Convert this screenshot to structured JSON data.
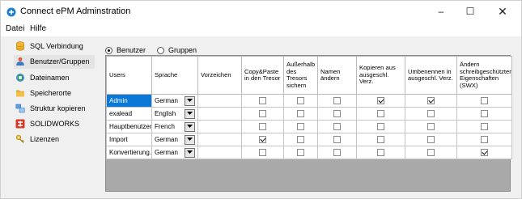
{
  "window": {
    "title": "Connect ePM Adminstration",
    "controls": {
      "minimize": "–",
      "maximize": "☐",
      "close": "✕"
    }
  },
  "menu": {
    "datei": "Datei",
    "hilfe": "Hilfe"
  },
  "sidebar": {
    "items": [
      {
        "label": "SQL Verbindung",
        "icon": "database-icon",
        "selected": false
      },
      {
        "label": "Benutzer/Gruppen",
        "icon": "users-icon",
        "selected": true
      },
      {
        "label": "Dateinamen",
        "icon": "filenames-icon",
        "selected": false
      },
      {
        "label": "Speicherorte",
        "icon": "folder-icon",
        "selected": false
      },
      {
        "label": "Struktur kopieren",
        "icon": "copy-structure-icon",
        "selected": false
      },
      {
        "label": "SOLIDWORKS",
        "icon": "solidworks-icon",
        "selected": false
      },
      {
        "label": "Lizenzen",
        "icon": "key-icon",
        "selected": false
      }
    ]
  },
  "mode": {
    "benutzer": "Benutzer",
    "gruppen": "Gruppen",
    "selected": "benutzer"
  },
  "table": {
    "columns": [
      "Users",
      "Sprache",
      "Vorzeichen",
      "Copy&Paste in den Tresor",
      "Außerhalb des Tresors sichern",
      "Namen ändern",
      "Kopieren aus ausgeschl. Verz.",
      "Umbenennen in ausgeschl. Verz.",
      "Ändern schreibgeschützter Eigenschaften (SWX)"
    ],
    "rows": [
      {
        "user": "Admin",
        "sprache": "German",
        "vorzeichen": "",
        "checks": [
          false,
          false,
          false,
          true,
          true,
          false
        ]
      },
      {
        "user": "exalead",
        "sprache": "English",
        "vorzeichen": "",
        "checks": [
          false,
          false,
          false,
          false,
          false,
          false
        ]
      },
      {
        "user": "Hauptbenutzer",
        "sprache": "French",
        "vorzeichen": "",
        "checks": [
          false,
          false,
          false,
          false,
          false,
          false
        ]
      },
      {
        "user": "Import",
        "sprache": "German",
        "vorzeichen": "",
        "checks": [
          true,
          false,
          false,
          false,
          false,
          false
        ]
      },
      {
        "user": "Konvertierung...",
        "sprache": "German",
        "vorzeichen": "",
        "checks": [
          false,
          false,
          false,
          false,
          false,
          true
        ]
      }
    ]
  },
  "colors": {
    "selection": "#0a78d7",
    "grid_empty": "#a9a9a9"
  }
}
